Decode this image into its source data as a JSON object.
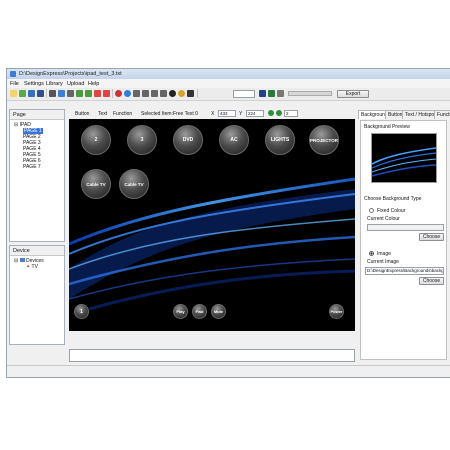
{
  "window": {
    "title": "D:\\DesignExpress\\Projects\\ipad_test_3.txt"
  },
  "menu": [
    "File",
    "Settings",
    "Library",
    "Upload",
    "Help"
  ],
  "toolbar": {
    "export_label": "Export"
  },
  "pages_panel": {
    "title": "Page",
    "root": "IPAD",
    "pages": [
      "PAGE 1",
      "PAGE 2",
      "PAGE 3",
      "PAGE 4",
      "PAGE 5",
      "PAGE 6",
      "PAGE 7"
    ],
    "selected": "PAGE 1"
  },
  "device_panel": {
    "title": "Device",
    "root": "Devices",
    "items": [
      "TV"
    ]
  },
  "editor_tabs": {
    "tabs": [
      "Button",
      "Text",
      "Function"
    ],
    "selected_item_label": "Selected Item:",
    "selected_item_value": "Free Text 0",
    "x_label": "X",
    "x_value": "432",
    "y_label": "Y",
    "y_value": "224",
    "zoom_value": "2"
  },
  "canvas": {
    "top_buttons": [
      "2",
      "3",
      "DVD",
      "AC",
      "LIGHTS",
      "PROJECTOR"
    ],
    "mid_buttons": [
      "Cable TV",
      "Cable TV"
    ],
    "bottom_left_button": "1",
    "bottom_buttons": [
      "Play",
      "Fwd",
      "Mute"
    ],
    "power_button": "Power"
  },
  "right_panel": {
    "tabs": [
      "Background",
      "Button",
      "Text / Hotspot",
      "Function"
    ],
    "active_tab": "Background",
    "preview_label": "Background Preview",
    "choose_type_label": "Choose Background Type",
    "fixed_colour_label": "Fixed Colour",
    "current_colour_label": "Current Colour",
    "choose_button_1": "Choose",
    "image_label": "Image",
    "current_image_label": "Current Image",
    "current_image_value": "D:\\DesignExpress\\Backgrounds\\backgrou",
    "choose_button_2": "Choose"
  }
}
